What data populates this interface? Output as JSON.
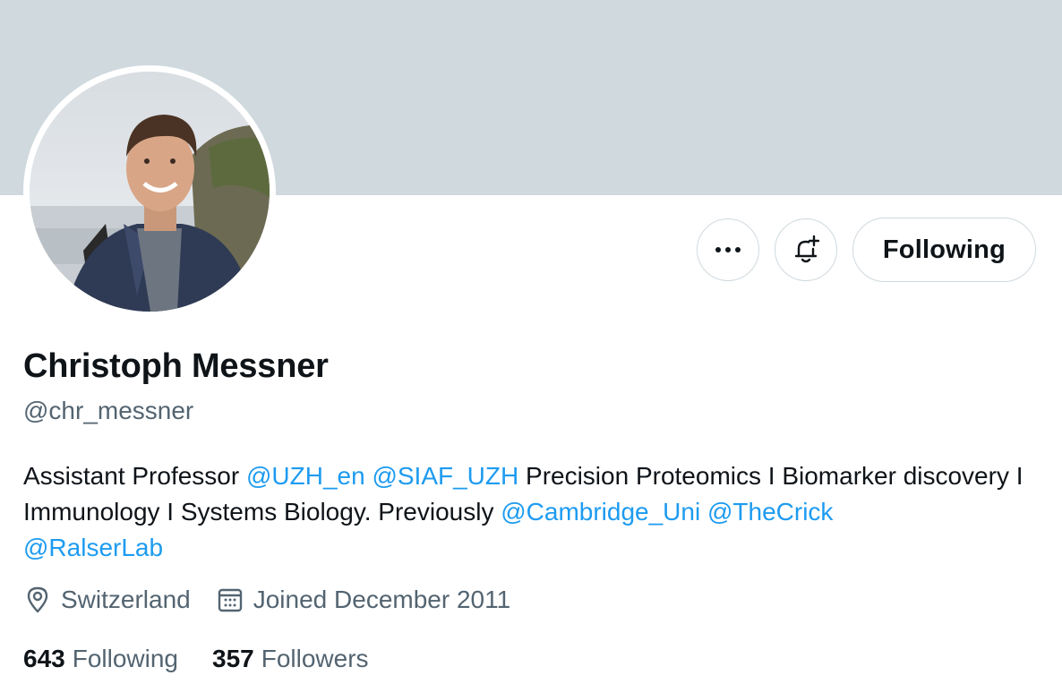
{
  "profile": {
    "name": "Christoph Messner",
    "handle": "@chr_messner",
    "bio": {
      "segments": [
        {
          "text": "Assistant Professor ",
          "type": "text"
        },
        {
          "text": "@UZH_en",
          "type": "mention"
        },
        {
          "text": " ",
          "type": "text"
        },
        {
          "text": "@SIAF_UZH",
          "type": "mention"
        },
        {
          "text": " Precision Proteomics I Biomarker discovery I Immunology I Systems Biology. Previously ",
          "type": "text"
        },
        {
          "text": "@Cambridge_Uni",
          "type": "mention"
        },
        {
          "text": " ",
          "type": "text"
        },
        {
          "text": "@TheCrick",
          "type": "mention"
        },
        {
          "text": " ",
          "type": "text"
        },
        {
          "text": "@RalserLab",
          "type": "mention"
        }
      ]
    },
    "location": "Switzerland",
    "joined": "Joined December 2011",
    "following_count": "643",
    "following_label": "Following",
    "followers_count": "357",
    "followers_label": "Followers"
  },
  "actions": {
    "more_icon": "more-icon",
    "notify_icon": "bell-plus-icon",
    "follow_label": "Following"
  },
  "colors": {
    "banner": "#cfd9de",
    "link": "#1d9bf0",
    "secondary_text": "#536471",
    "primary_text": "#0f1419",
    "border": "#cfd9de"
  }
}
